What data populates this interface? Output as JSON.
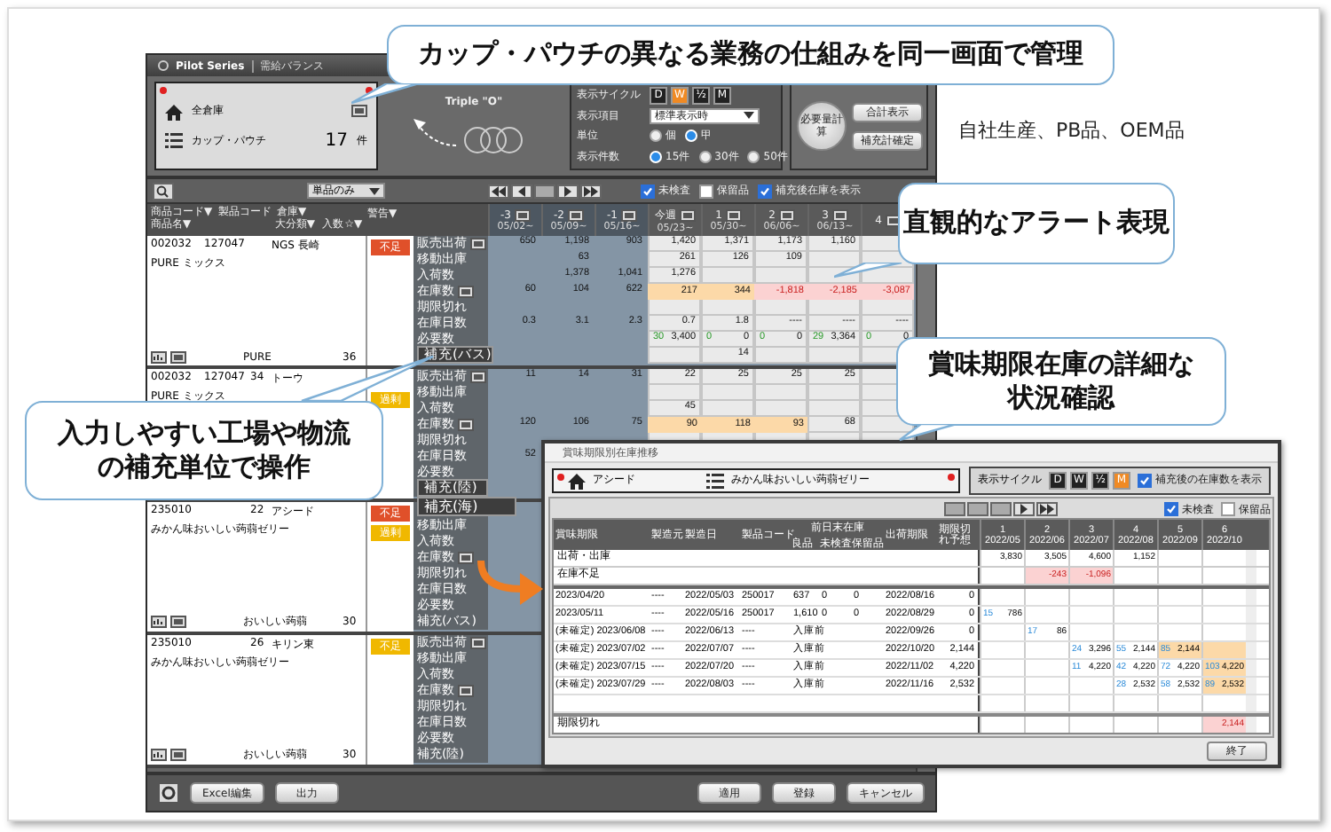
{
  "window": {
    "brand": "Pilot Series",
    "title": "需給バランス"
  },
  "scope": {
    "warehouse": "全倉庫",
    "category": "カップ・パウチ",
    "count": "17",
    "count_unit": "件"
  },
  "logo": {
    "text": "Triple \"O\""
  },
  "settings": {
    "cycle_label": "表示サイクル",
    "cycles": [
      {
        "label": "D",
        "selected": false
      },
      {
        "label": "W",
        "selected": true
      },
      {
        "label": "½",
        "selected": false
      },
      {
        "label": "M",
        "selected": false
      }
    ],
    "items_label": "表示項目",
    "items_value": "標準表示時",
    "unit_label": "単位",
    "units": [
      {
        "label": "個",
        "selected": false
      },
      {
        "label": "甲",
        "selected": true
      }
    ],
    "rows_label": "表示件数",
    "rows_options": [
      {
        "label": "15件",
        "selected": true
      },
      {
        "label": "30件",
        "selected": false
      },
      {
        "label": "50件",
        "selected": false
      }
    ]
  },
  "actions": {
    "calc": "必要量計算",
    "buttons": [
      "合計表示",
      "補充計確定"
    ]
  },
  "toolbar": {
    "filter": "単品のみ",
    "checks": [
      {
        "label": "未検査",
        "checked": true
      },
      {
        "label": "保留品",
        "checked": false
      },
      {
        "label": "補充後在庫を表示",
        "checked": true
      }
    ]
  },
  "grid": {
    "header": {
      "code": "商品コード▼",
      "product_code": "製品コード",
      "name": "商品名▼",
      "warehouse": "倉庫▼",
      "category": "大分類▼",
      "qty": "入数",
      "star": "☆▼",
      "alert": "警告▼"
    },
    "weeks": [
      {
        "label": "-3",
        "date": "05/02~",
        "past": true
      },
      {
        "label": "-2",
        "date": "05/09~",
        "past": true
      },
      {
        "label": "-1",
        "date": "05/16~",
        "past": true
      },
      {
        "label": "今週",
        "date": "05/23~",
        "past": false
      },
      {
        "label": "1",
        "date": "05/30~",
        "past": false
      },
      {
        "label": "2",
        "date": "06/06~",
        "past": false
      },
      {
        "label": "3",
        "date": "06/13~",
        "past": false
      },
      {
        "label": "4",
        "past": false
      }
    ],
    "products": [
      {
        "code": "002032",
        "product_code": "127047",
        "warehouse": "NGS 長崎",
        "name": "PURE ミックス",
        "brand": "PURE",
        "qty": "36",
        "alerts": [
          {
            "label": "不足",
            "kind": "shortage",
            "color": "#e0502a"
          }
        ],
        "rows": [
          {
            "label": "販売出荷",
            "kind": "button-row",
            "values": [
              "650",
              "1,198",
              "903",
              "1,420",
              "1,371",
              "1,173",
              "1,160"
            ]
          },
          {
            "label": "移動出庫",
            "kind": "row",
            "values": [
              {
                "kind": "empty"
              },
              "63",
              {
                "kind": "empty"
              },
              "261",
              "126",
              "109"
            ]
          },
          {
            "label": "入荷数",
            "kind": "row",
            "values": [
              {
                "kind": "empty"
              },
              "1,378",
              "1,041",
              "1,276"
            ]
          },
          {
            "label": "在庫数",
            "kind": "button-row",
            "values": [
              "60",
              "104",
              "622",
              {
                "value": "217",
                "highlight": true
              },
              {
                "value": "344",
                "highlight": true
              },
              {
                "value": "-1,818",
                "alert": true
              },
              {
                "value": "-2,185",
                "alert": true
              },
              {
                "value": "-3,087",
                "alert": true
              }
            ]
          },
          {
            "label": "期限切れ",
            "kind": "row"
          },
          {
            "label": "在庫日数",
            "kind": "row",
            "values": [
              "0.3",
              "3.1",
              "2.3",
              "0.7",
              "1.8",
              "----",
              "----",
              "----"
            ]
          },
          {
            "label": "必要数",
            "kind": "row",
            "values": [
              {
                "kind": "empty"
              },
              {
                "kind": "empty"
              },
              {
                "kind": "empty"
              },
              {
                "note": "30",
                "value": "3,400"
              },
              {
                "note": "0",
                "value": "0"
              },
              {
                "note": "0",
                "value": "0"
              },
              {
                "note": "29",
                "value": "3,364"
              },
              {
                "note": "0",
                "value": "0"
              }
            ]
          },
          {
            "label": "補充(バス)",
            "kind": "select",
            "values": [
              {
                "kind": "empty"
              },
              {
                "kind": "empty"
              },
              {
                "kind": "empty"
              },
              {
                "kind": "empty"
              },
              "14"
            ]
          }
        ]
      },
      {
        "code": "002032",
        "product_code": "127047",
        "extra": "34",
        "warehouse": "トーウ",
        "name": "PURE ミックス",
        "alerts": [
          {
            "label": "過剰",
            "kind": "excess",
            "color": "#f0b800"
          }
        ],
        "rows": [
          {
            "label": "販売出荷",
            "kind": "button-row",
            "values": [
              "11",
              "14",
              "31",
              "22",
              "25",
              "25",
              "25"
            ]
          },
          {
            "label": "移動出庫",
            "kind": "row"
          },
          {
            "label": "入荷数",
            "kind": "row",
            "values": [
              {
                "kind": "empty"
              },
              {
                "kind": "empty"
              },
              {
                "kind": "empty"
              },
              "45"
            ]
          },
          {
            "label": "在庫数",
            "kind": "button-row",
            "values": [
              "120",
              "106",
              "75",
              {
                "value": "90",
                "highlight": true
              },
              {
                "value": "118",
                "highlight": true
              },
              {
                "value": "93",
                "highlight": true
              },
              "68"
            ]
          },
          {
            "label": "期限切れ",
            "kind": "row"
          },
          {
            "label": "在庫日数",
            "kind": "row",
            "values": [
              "52"
            ]
          },
          {
            "label": "必要数",
            "kind": "row"
          },
          {
            "label": "補充(陸)",
            "kind": "select",
            "options": [
              "補充(海)"
            ]
          }
        ]
      },
      {
        "code": "235010",
        "extra": "22",
        "warehouse": "アシード",
        "name": "みかん味おいしい蒟蒻ゼリー",
        "brand": "おいしい蒟蒻",
        "qty": "30",
        "alerts": [
          {
            "label": "不足",
            "kind": "shortage",
            "color": "#e0502a"
          },
          {
            "label": "過剰",
            "kind": "excess",
            "color": "#f0b800"
          }
        ],
        "rows": [
          {
            "kind": "row"
          },
          {
            "label": "移動出庫",
            "kind": "row"
          },
          {
            "label": "入荷数",
            "kind": "row"
          },
          {
            "label": "在庫数",
            "kind": "button-row"
          },
          {
            "label": "期限切れ",
            "kind": "row"
          },
          {
            "label": "在庫日数",
            "kind": "row"
          },
          {
            "label": "必要数",
            "kind": "row"
          },
          {
            "label": "補充(バス)",
            "kind": "row"
          }
        ]
      },
      {
        "code": "235010",
        "extra": "26",
        "warehouse": "キリン東",
        "name": "みかん味おいしい蒟蒻ゼリー",
        "brand": "おいしい蒟蒻",
        "qty": "30",
        "alerts": [
          {
            "label": "不足",
            "kind": "shortage",
            "color": "#f0b800"
          }
        ],
        "rows": [
          {
            "label": "販売出荷",
            "kind": "button-row"
          },
          {
            "label": "移動出庫",
            "kind": "row"
          },
          {
            "label": "入荷数",
            "kind": "row"
          },
          {
            "label": "在庫数",
            "kind": "button-row"
          },
          {
            "label": "期限切れ",
            "kind": "row"
          },
          {
            "label": "在庫日数",
            "kind": "row"
          },
          {
            "label": "必要数",
            "kind": "row"
          },
          {
            "label": "補充(陸)",
            "kind": "row"
          }
        ]
      }
    ]
  },
  "bottom": {
    "left": [
      "Excel編集",
      "出力"
    ],
    "right": [
      "適用",
      "登録",
      "キャンセル"
    ]
  },
  "dialog": {
    "title": "賞味期限別在庫推移",
    "warehouse": "アシード",
    "product": "みかん味おいしい蒟蒻ゼリー",
    "cycle_label": "表示サイクル",
    "cycles": [
      {
        "label": "D",
        "selected": false
      },
      {
        "label": "W",
        "selected": false
      },
      {
        "label": "½",
        "selected": false
      },
      {
        "label": "M",
        "selected": true
      }
    ],
    "show_after": {
      "label": "補充後の在庫数を表示",
      "checked": true
    },
    "checks": [
      {
        "label": "未検査",
        "checked": true
      },
      {
        "label": "保留品",
        "checked": false
      }
    ],
    "columns": [
      "賞味期限",
      "製造元",
      "製造日",
      "製品コード"
    ],
    "stock_header": "前日末在庫",
    "stock_columns": [
      "良品",
      "未検査",
      "保留品"
    ],
    "columns_after": [
      "出荷期限",
      "期限切れ予想"
    ],
    "months": [
      {
        "label": "1",
        "date": "2022/05"
      },
      {
        "label": "2",
        "date": "2022/06"
      },
      {
        "label": "3",
        "date": "2022/07"
      },
      {
        "label": "4",
        "date": "2022/08"
      },
      {
        "label": "5",
        "date": "2022/09"
      },
      {
        "label": "6",
        "date": "2022/10"
      }
    ],
    "summary": [
      {
        "label": "出荷・出庫",
        "values": [
          "3,830",
          "3,505",
          "4,600",
          "1,152"
        ]
      },
      {
        "label": "在庫不足",
        "values": [
          {
            "kind": "empty"
          },
          {
            "value": "-243",
            "alert": true
          },
          {
            "value": "-1,096",
            "alert": true
          }
        ]
      }
    ],
    "lots": [
      {
        "expiry": "2023/04/20",
        "maker": "----",
        "made": "2022/05/03",
        "code": "250017",
        "good": "637",
        "uninspected": "0",
        "held": "0",
        "ship_by": "2022/08/16",
        "forecast": "0"
      },
      {
        "expiry": "2023/05/11",
        "maker": "----",
        "made": "2022/05/16",
        "code": "250017",
        "good": "1,610",
        "uninspected": "0",
        "held": "0",
        "ship_by": "2022/08/29",
        "forecast": "0",
        "months": [
          {
            "note": "15",
            "value": "786"
          }
        ]
      },
      {
        "expiry": "(未確定) 2023/06/08",
        "maker": "----",
        "made": "2022/06/13",
        "code": "----",
        "good": "入庫前",
        "ship_by": "2022/09/26",
        "forecast": "0",
        "months": [
          {
            "kind": "empty"
          },
          {
            "note": "17",
            "value": "86"
          }
        ]
      },
      {
        "expiry": "(未確定) 2023/07/02",
        "maker": "----",
        "made": "2022/07/07",
        "code": "----",
        "good": "入庫前",
        "ship_by": "2022/10/20",
        "forecast": "2,144",
        "months": [
          {
            "kind": "empty"
          },
          {
            "kind": "empty"
          },
          {
            "note": "24",
            "value": "3,296"
          },
          {
            "note": "55",
            "value": "2,144"
          },
          {
            "note": "85",
            "value": "2,144",
            "highlight": true
          },
          {
            "kind": "box",
            "highlight": true
          }
        ]
      },
      {
        "expiry": "(未確定) 2023/07/15",
        "maker": "----",
        "made": "2022/07/20",
        "code": "----",
        "good": "入庫前",
        "ship_by": "2022/11/02",
        "forecast": "4,220",
        "months": [
          {
            "kind": "empty"
          },
          {
            "kind": "empty"
          },
          {
            "note": "11",
            "value": "4,220"
          },
          {
            "note": "42",
            "value": "4,220"
          },
          {
            "note": "72",
            "value": "4,220"
          },
          {
            "note": "103",
            "value": "4,220",
            "highlight": true
          }
        ]
      },
      {
        "expiry": "(未確定) 2023/07/29",
        "maker": "----",
        "made": "2022/08/03",
        "code": "----",
        "good": "入庫前",
        "ship_by": "2022/11/16",
        "forecast": "2,532",
        "months": [
          {
            "kind": "empty"
          },
          {
            "kind": "empty"
          },
          {
            "kind": "empty"
          },
          {
            "note": "28",
            "value": "2,532"
          },
          {
            "note": "58",
            "value": "2,532"
          },
          {
            "note": "89",
            "value": "2,532",
            "highlight": true
          }
        ]
      }
    ],
    "footer": {
      "label": "期限切れ",
      "values": [
        {
          "kind": "empty"
        },
        {
          "kind": "empty"
        },
        {
          "kind": "empty"
        },
        {
          "kind": "empty"
        },
        {
          "kind": "empty"
        },
        {
          "value": "2,144",
          "alert": true
        }
      ]
    },
    "close": "終了"
  },
  "callouts": [
    {
      "text": "カップ・パウチの異なる業務の仕組みを同一画面で管理",
      "kind": "top"
    },
    {
      "text": "直観的なアラート表現",
      "kind": "alert"
    },
    {
      "text": "賞味期限在庫の詳細な状況確認",
      "kind": "detail"
    },
    {
      "text": "入力しやすい工場や物流の補充単位で操作",
      "kind": "input"
    }
  ],
  "note": "自社生産、PB品、OEM品"
}
